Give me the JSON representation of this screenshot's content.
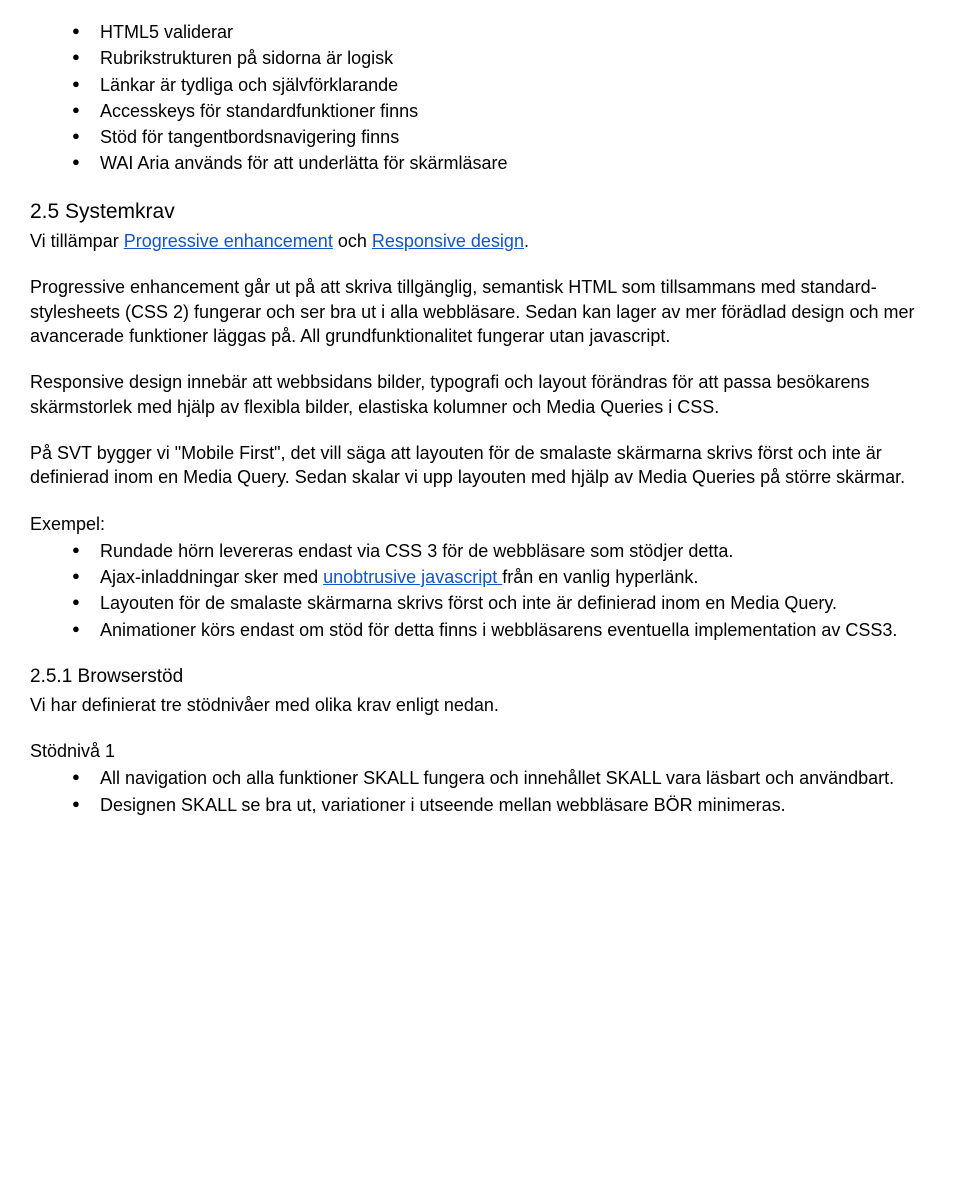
{
  "list1": {
    "items": [
      "HTML5 validerar",
      "Rubrikstrukturen på sidorna är logisk",
      "Länkar är tydliga och självförklarande",
      "Accesskeys för standardfunktioner finns",
      "Stöd för tangentbordsnavigering finns",
      "WAI Aria används för att underlätta för skärmläsare"
    ]
  },
  "h_systemkrav": "2.5 Systemkrav",
  "p_intro_a": "Vi tillämpar ",
  "link_pe": "Progressive enhancement",
  "p_intro_b": " och ",
  "link_rd": "Responsive design",
  "p_intro_c": ".",
  "p_pe": "Progressive enhancement går ut på att skriva tillgänglig, semantisk HTML som tillsammans med standard-stylesheets (CSS 2) fungerar och ser bra ut i alla webbläsare. Sedan kan lager av mer förädlad design och mer avancerade funktioner läggas på. All grundfunktionalitet fungerar utan javascript.",
  "p_rd": "Responsive design innebär att webbsidans bilder, typografi och layout förändras för att passa besökarens skärmstorlek med hjälp av flexibla bilder, elastiska kolumner och Media Queries i CSS.",
  "p_mobile": "På SVT bygger vi \"Mobile First\", det vill säga att layouten för de smalaste skärmarna skrivs först och inte är definierad inom en Media Query. Sedan skalar vi upp layouten med hjälp av Media Queries på större skärmar.",
  "exempel_label": "Exempel:",
  "list2": {
    "item0": "Rundade hörn levereras endast via CSS 3 för de webbläsare som stödjer detta.",
    "item1a": "Ajax-inladdningar sker med ",
    "item1_link": "unobtrusive javascript ",
    "item1b": "från en vanlig hyperlänk.",
    "item2": "Layouten för de smalaste skärmarna skrivs först och inte är definierad inom en Media Query.",
    "item3": "Animationer körs endast om stöd för detta finns i webbläsarens eventuella implementation av CSS3."
  },
  "h_browser": "2.5.1 Browserstöd",
  "p_browser": "Vi har definierat tre stödnivåer med olika krav enligt nedan.",
  "stod1_label": "Stödnivå 1",
  "list3": {
    "item0": "All navigation och alla funktioner SKALL fungera och innehållet SKALL vara läsbart och användbart.",
    "item1": "Designen SKALL se bra ut, variationer i utseende mellan webbläsare BÖR minimeras."
  }
}
